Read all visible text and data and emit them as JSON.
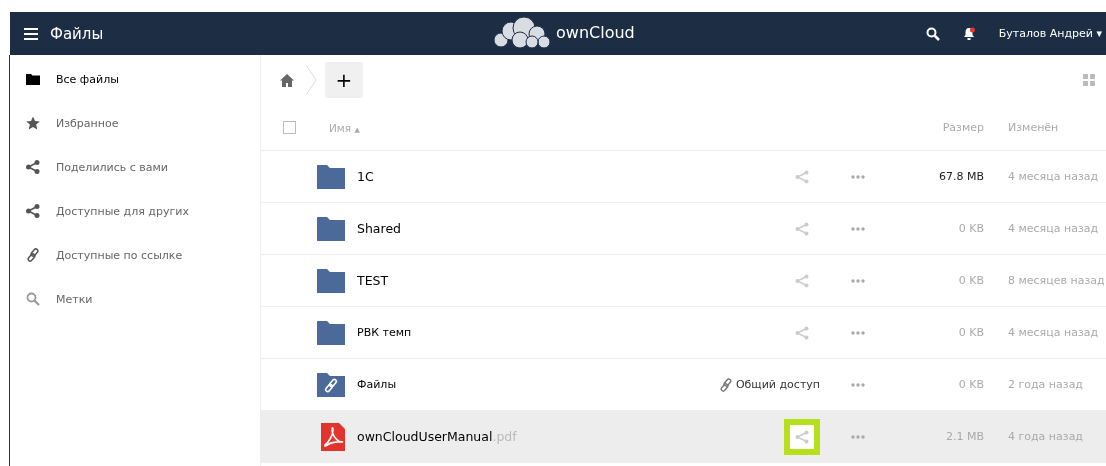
{
  "header": {
    "app_title": "Файлы",
    "brand": "ownCloud",
    "user": "Буталов Андрей",
    "user_caret": "▾",
    "notification_unread": true
  },
  "sidebar": {
    "items": [
      {
        "label": "Все файлы",
        "kind": "folder",
        "selected": true
      },
      {
        "label": "Избранное",
        "kind": "star",
        "selected": false
      },
      {
        "label": "Поделились с вами",
        "kind": "share",
        "selected": false
      },
      {
        "label": "Доступные для других",
        "kind": "share",
        "selected": false
      },
      {
        "label": "Доступные по ссылке",
        "kind": "link",
        "selected": false
      },
      {
        "label": "Метки",
        "kind": "search",
        "selected": false
      }
    ]
  },
  "toolbar": {
    "new_button": "+"
  },
  "table": {
    "columns": {
      "name": "Имя",
      "name_sort_indicator": "▲",
      "size": "Размер",
      "modified": "Изменён"
    },
    "select_all_checked": false,
    "rows": [
      {
        "kind": "folder",
        "name": "1C",
        "size": "67.8 MB",
        "size_emphasis": true,
        "modified": "4 месяца назад",
        "hovered": false,
        "highlighted": false
      },
      {
        "kind": "folder",
        "name": "Shared",
        "size": "0 KB",
        "size_emphasis": false,
        "modified": "4 месяца назад",
        "hovered": false,
        "highlighted": false
      },
      {
        "kind": "folder",
        "name": "TEST",
        "size": "0 KB",
        "size_emphasis": false,
        "modified": "8 месяцев назад",
        "hovered": false,
        "highlighted": false
      },
      {
        "kind": "folder",
        "name": "РВК темп",
        "size": "0 KB",
        "size_emphasis": false,
        "modified": "4 месяца назад",
        "hovered": false,
        "highlighted": false
      },
      {
        "kind": "link-folder",
        "name": "Файлы",
        "share_label": "Общий доступ",
        "size": "0 KB",
        "size_emphasis": false,
        "modified": "2 года назад",
        "hovered": false
      },
      {
        "kind": "pdf",
        "name": "ownCloudUserManual",
        "extension": ".pdf",
        "size": "2.1 MB",
        "size_emphasis": false,
        "modified": "4 года назад",
        "hovered": true,
        "highlighted": true
      }
    ]
  }
}
